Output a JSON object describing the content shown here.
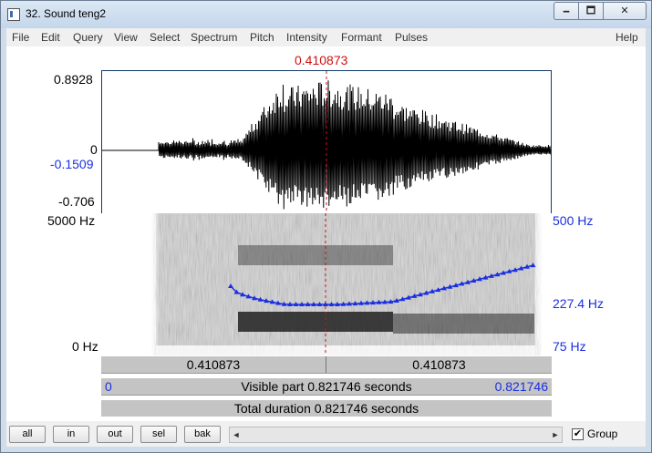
{
  "window": {
    "title": "32. Sound teng2",
    "min_glyph": "🗕",
    "max_glyph": "🗖",
    "close_glyph": "✕"
  },
  "menu": [
    "File",
    "Edit",
    "Query",
    "View",
    "Select",
    "Spectrum",
    "Pitch",
    "Intensity",
    "Formant",
    "Pulses",
    "Help"
  ],
  "cursor": {
    "time_label": "0.410873",
    "color": "#d01010"
  },
  "waveform": {
    "top_label": "0.8928",
    "zero_label": "0",
    "cursor_value_label": "-0.1509",
    "bottom_label": "-0.706"
  },
  "spectrogram": {
    "left_top": "5000 Hz",
    "left_bottom": "0 Hz",
    "right_top": "500 Hz",
    "right_mid": "227.4 Hz",
    "right_bottom": "75 Hz",
    "pitch_color": "#1a2fe0"
  },
  "bars": {
    "left_part": "0.410873",
    "right_part": "0.410873",
    "visible_start": "0",
    "visible_label": "Visible part 0.821746 seconds",
    "visible_end": "0.821746",
    "total_label": "Total duration 0.821746 seconds"
  },
  "buttons": {
    "all": "all",
    "in": "in",
    "out": "out",
    "sel": "sel",
    "bak": "bak"
  },
  "scroll": {
    "left_arrow": "◄",
    "right_arrow": "►"
  },
  "group": {
    "label": "Group",
    "checked": true,
    "check_glyph": "✔"
  }
}
